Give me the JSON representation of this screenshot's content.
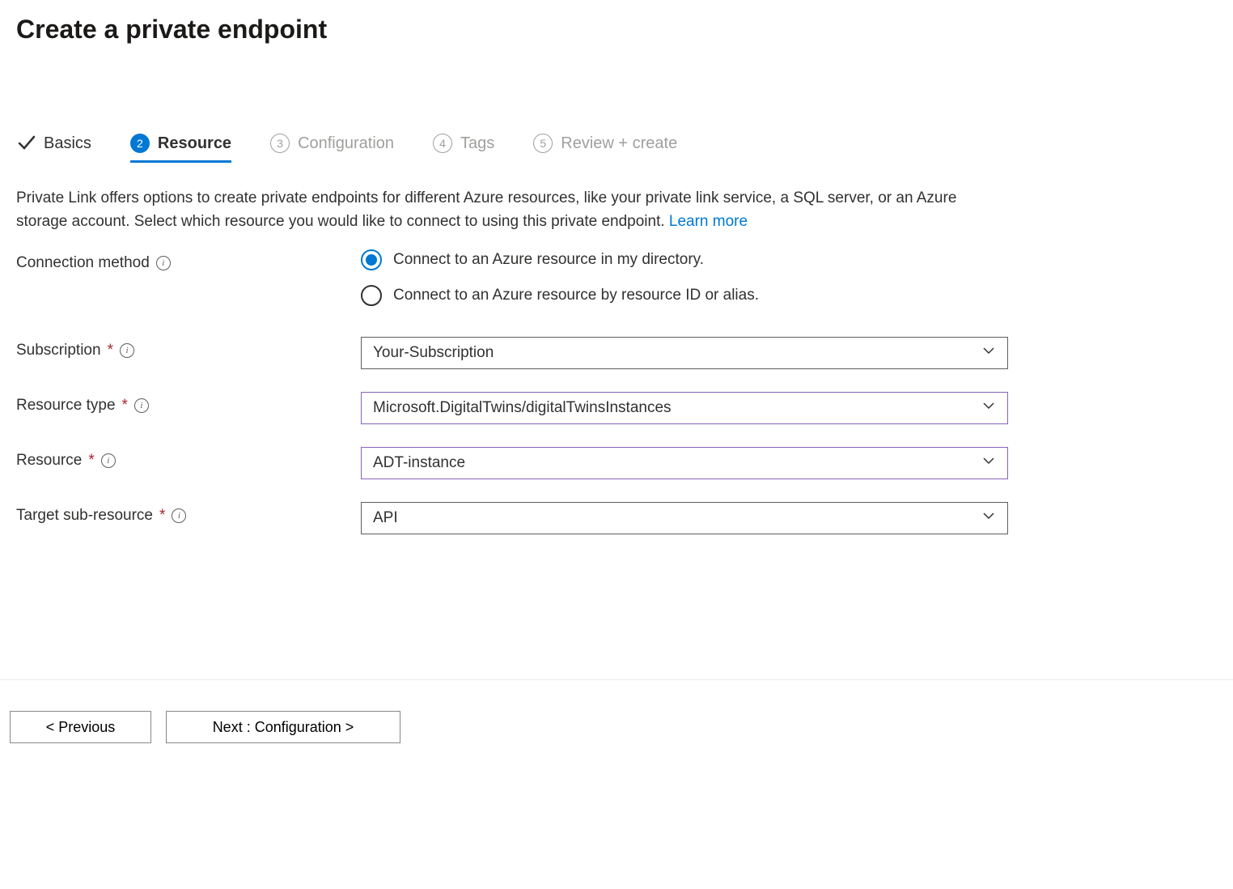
{
  "page_title": "Create a private endpoint",
  "tabs": [
    {
      "label": "Basics",
      "state": "completed"
    },
    {
      "num": "2",
      "label": "Resource",
      "state": "active"
    },
    {
      "num": "3",
      "label": "Configuration",
      "state": "pending"
    },
    {
      "num": "4",
      "label": "Tags",
      "state": "pending"
    },
    {
      "num": "5",
      "label": "Review + create",
      "state": "pending"
    }
  ],
  "description": "Private Link offers options to create private endpoints for different Azure resources, like your private link service, a SQL server, or an Azure storage account. Select which resource you would like to connect to using this private endpoint.  ",
  "learn_more": "Learn more",
  "labels": {
    "connection_method": "Connection method",
    "subscription": "Subscription",
    "resource_type": "Resource type",
    "resource": "Resource",
    "target_sub_resource": "Target sub-resource"
  },
  "connection_method_options": [
    {
      "label": "Connect to an Azure resource in my directory.",
      "checked": true
    },
    {
      "label": "Connect to an Azure resource by resource ID or alias.",
      "checked": false
    }
  ],
  "fields": {
    "subscription": "Your-Subscription",
    "resource_type": "Microsoft.DigitalTwins/digitalTwinsInstances",
    "resource": "ADT-instance",
    "target_sub_resource": "API"
  },
  "buttons": {
    "previous": "< Previous",
    "next": "Next : Configuration >"
  },
  "colors": {
    "accent": "#0078d4",
    "highlight_border": "#8764b8",
    "required": "#a4262c"
  }
}
